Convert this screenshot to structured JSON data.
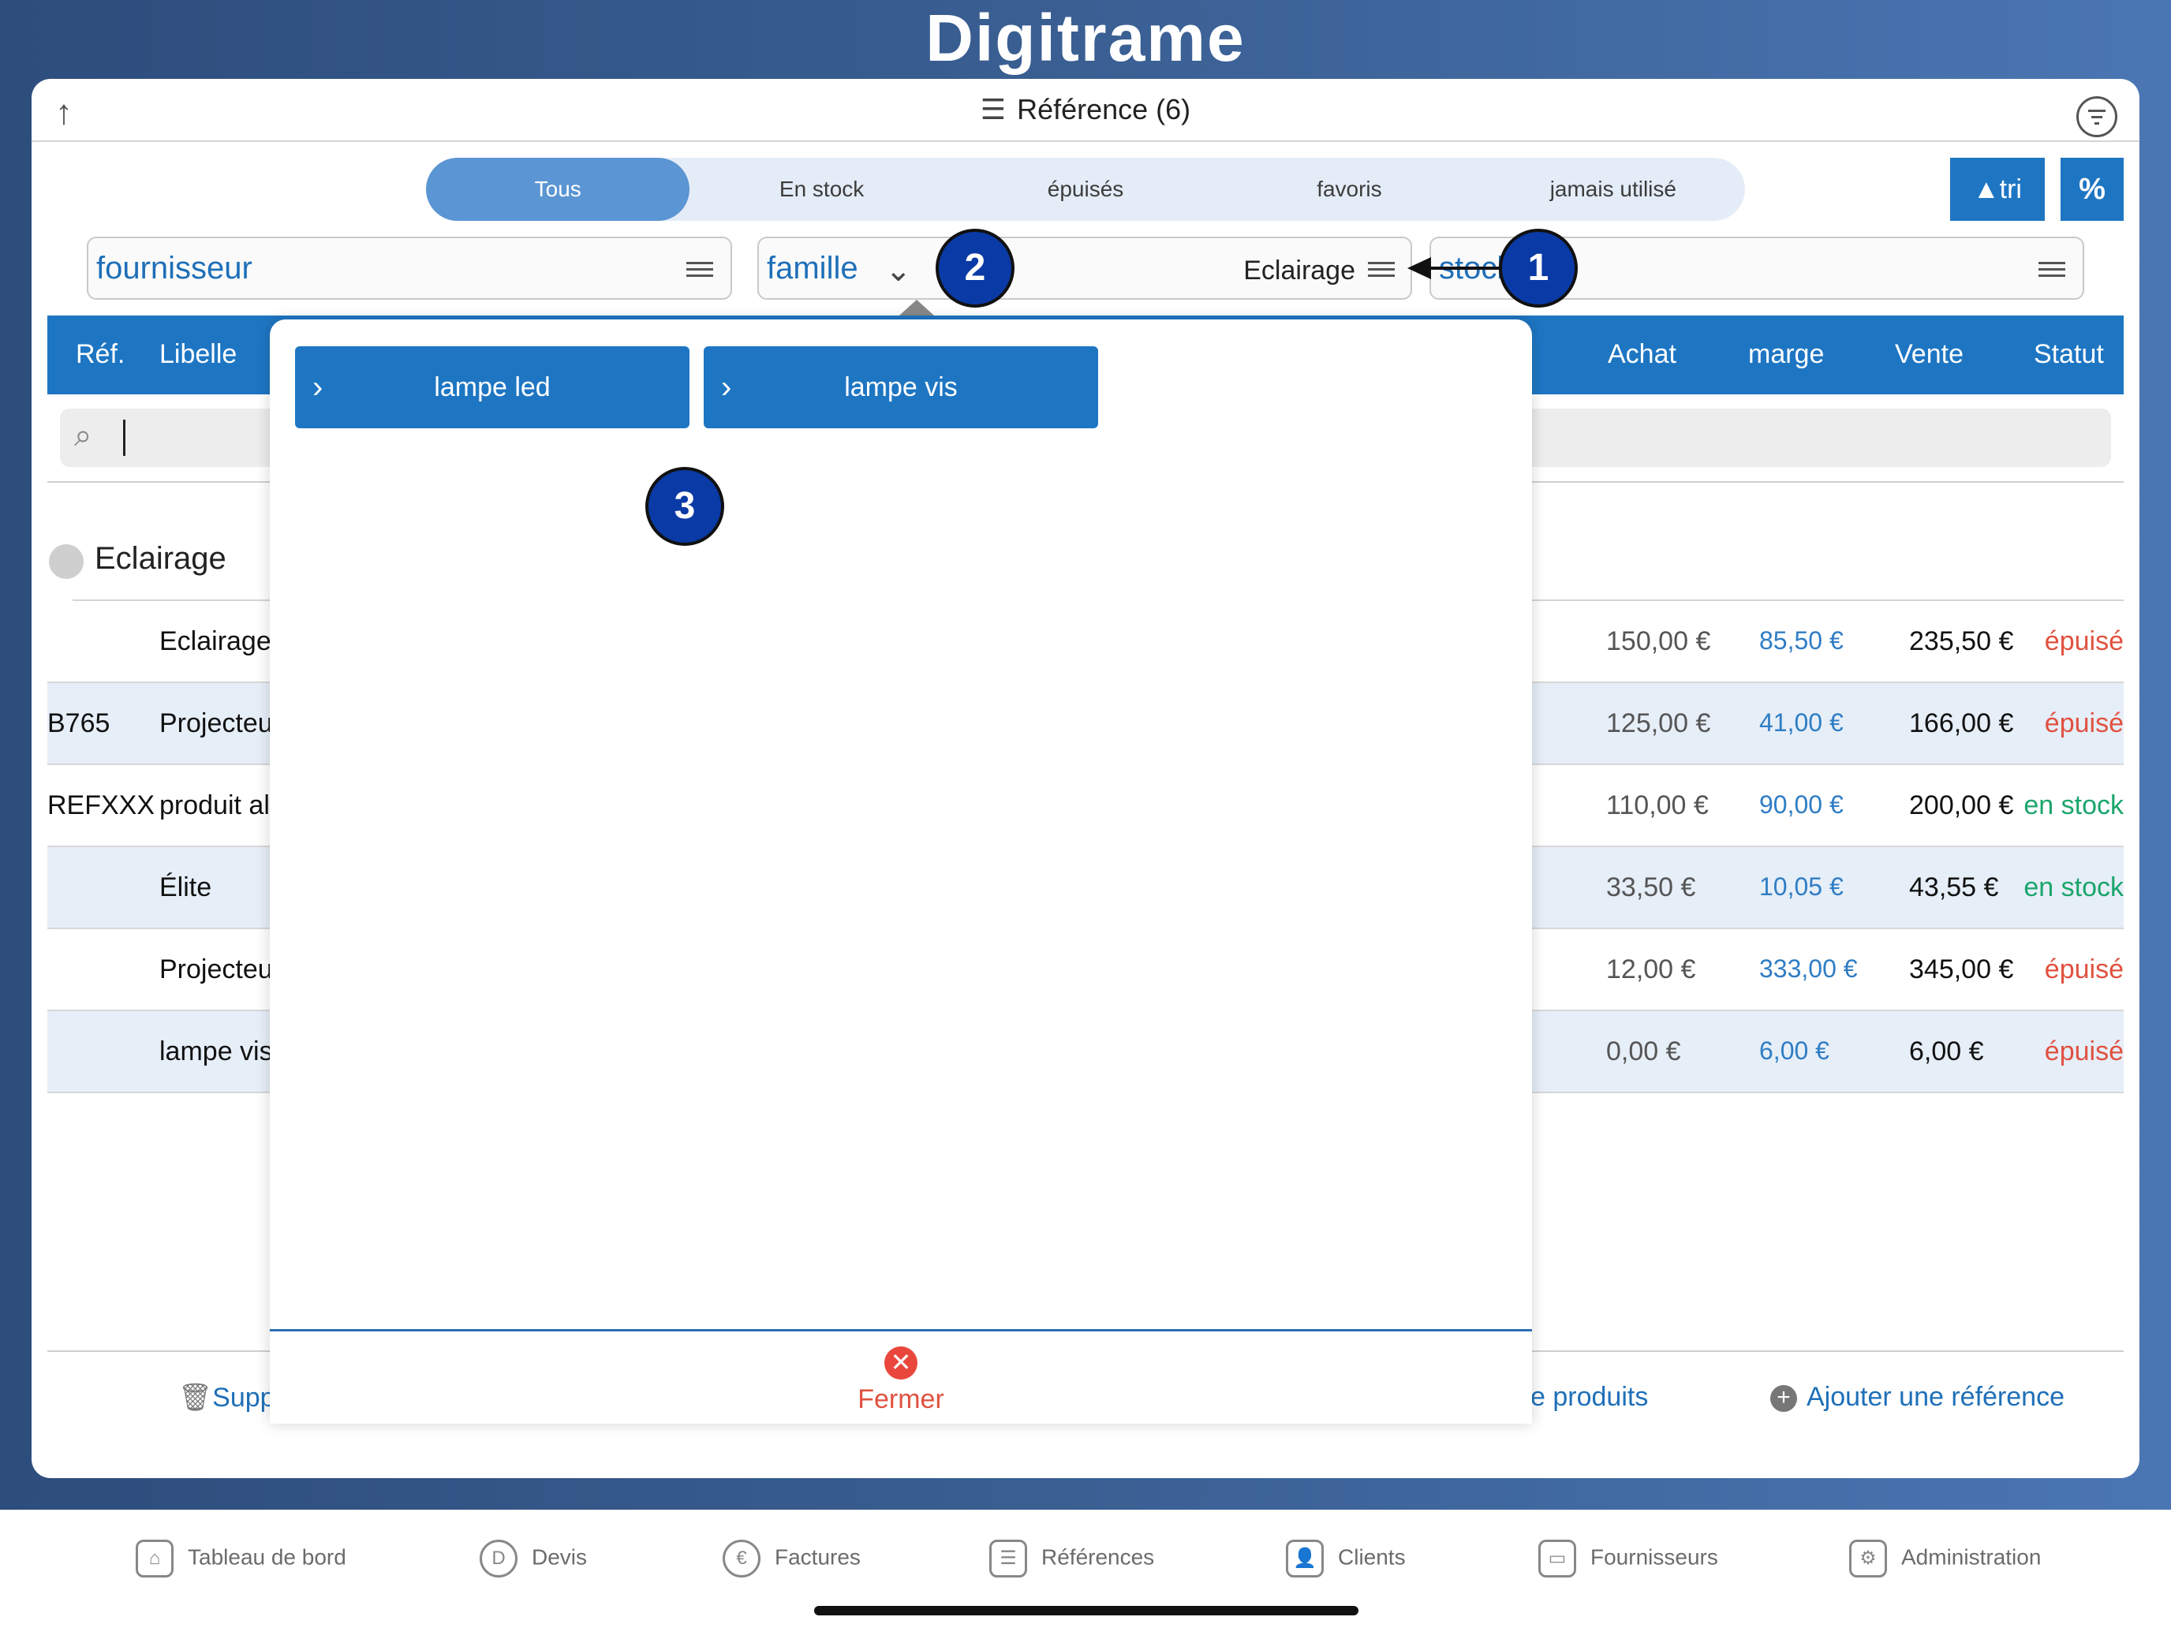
{
  "app": {
    "brand": "Digitrame"
  },
  "header": {
    "title": "Référence (6)"
  },
  "segments": [
    "Tous",
    "En stock",
    "épuisés",
    "favoris",
    "jamais utilisé"
  ],
  "buttons": {
    "tri": "▲tri",
    "percent": "%"
  },
  "filters": {
    "fournisseur": "fournisseur",
    "famille": "famille",
    "famille_value": "Eclairage",
    "stock": "stock"
  },
  "table": {
    "headers": {
      "ref": "Réf.",
      "libelle": "Libelle",
      "achat": "Achat",
      "marge": "marge",
      "vente": "Vente",
      "statut": "Statut"
    },
    "group": "Eclairage",
    "rows": [
      {
        "ref": "",
        "libelle": "Eclairage",
        "achat": "150,00 €",
        "marge": "85,50 €",
        "vente": "235,50 €",
        "statut": "épuisé"
      },
      {
        "ref": "B765",
        "libelle": "Projecteu",
        "achat": "125,00 €",
        "marge": "41,00 €",
        "vente": "166,00 €",
        "statut": "épuisé"
      },
      {
        "ref": "REFXXX",
        "libelle": "produit al",
        "achat": "110,00 €",
        "marge": "90,00 €",
        "vente": "200,00 €",
        "statut": "en stock"
      },
      {
        "ref": "",
        "libelle": "Élite",
        "achat": "33,50 €",
        "marge": "10,05 €",
        "vente": "43,55 €",
        "statut": "en stock"
      },
      {
        "ref": "",
        "libelle": "Projecteu",
        "achat": "12,00 €",
        "marge": "333,00 €",
        "vente": "345,00 €",
        "statut": "épuisé"
      },
      {
        "ref": "",
        "libelle": "lampe vis",
        "achat": "0,00 €",
        "marge": "6,00 €",
        "vente": "6,00 €",
        "statut": "épuisé"
      }
    ]
  },
  "actions": {
    "delete": "Supp",
    "produits": "e produits",
    "add": "Ajouter une référence"
  },
  "modal": {
    "chips": [
      "lampe led",
      "lampe vis"
    ],
    "close": "Fermer"
  },
  "annotations": [
    "1",
    "2",
    "3"
  ],
  "tabbar": [
    "Tableau de bord",
    "Devis",
    "Factures",
    "Références",
    "Clients",
    "Fournisseurs",
    "Administration"
  ],
  "colors": {
    "primary": "#1e76c3",
    "danger": "#e0513f",
    "success": "#1aa56b",
    "annotation": "#0a3aa5"
  }
}
